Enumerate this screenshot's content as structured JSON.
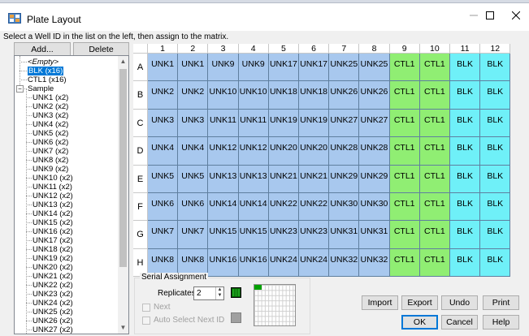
{
  "window": {
    "title": "Plate Layout"
  },
  "instruction": "Select a Well ID in the list on the left, then assign to the matrix.",
  "list_buttons": {
    "add": "Add...",
    "delete": "Delete"
  },
  "tree": {
    "items": [
      {
        "label": "<Empty>",
        "level": 1,
        "selected": false,
        "italic": true
      },
      {
        "label": "BLK (x16)",
        "level": 1,
        "selected": true
      },
      {
        "label": "CTL1 (x16)",
        "level": 1,
        "selected": false
      },
      {
        "label": "Sample",
        "level": 1,
        "selected": false,
        "expander": "−"
      },
      {
        "label": "UNK1 (x2)",
        "level": 2
      },
      {
        "label": "UNK2 (x2)",
        "level": 2
      },
      {
        "label": "UNK3 (x2)",
        "level": 2
      },
      {
        "label": "UNK4 (x2)",
        "level": 2
      },
      {
        "label": "UNK5 (x2)",
        "level": 2
      },
      {
        "label": "UNK6 (x2)",
        "level": 2
      },
      {
        "label": "UNK7 (x2)",
        "level": 2
      },
      {
        "label": "UNK8 (x2)",
        "level": 2
      },
      {
        "label": "UNK9 (x2)",
        "level": 2
      },
      {
        "label": "UNK10 (x2)",
        "level": 2
      },
      {
        "label": "UNK11 (x2)",
        "level": 2
      },
      {
        "label": "UNK12 (x2)",
        "level": 2
      },
      {
        "label": "UNK13 (x2)",
        "level": 2
      },
      {
        "label": "UNK14 (x2)",
        "level": 2
      },
      {
        "label": "UNK15 (x2)",
        "level": 2
      },
      {
        "label": "UNK16 (x2)",
        "level": 2
      },
      {
        "label": "UNK17 (x2)",
        "level": 2
      },
      {
        "label": "UNK18 (x2)",
        "level": 2
      },
      {
        "label": "UNK19 (x2)",
        "level": 2
      },
      {
        "label": "UNK20 (x2)",
        "level": 2
      },
      {
        "label": "UNK21 (x2)",
        "level": 2
      },
      {
        "label": "UNK22 (x2)",
        "level": 2
      },
      {
        "label": "UNK23 (x2)",
        "level": 2
      },
      {
        "label": "UNK24 (x2)",
        "level": 2
      },
      {
        "label": "UNK25 (x2)",
        "level": 2
      },
      {
        "label": "UNK26 (x2)",
        "level": 2
      },
      {
        "label": "UNK27 (x2)",
        "level": 2
      }
    ]
  },
  "plate": {
    "columns": [
      "1",
      "2",
      "3",
      "4",
      "5",
      "6",
      "7",
      "8",
      "9",
      "10",
      "11",
      "12"
    ],
    "rows": [
      {
        "label": "A",
        "cells": [
          "UNK1",
          "UNK1",
          "UNK9",
          "UNK9",
          "UNK17",
          "UNK17",
          "UNK25",
          "UNK25",
          "CTL1",
          "CTL1",
          "BLK",
          "BLK"
        ]
      },
      {
        "label": "B",
        "cells": [
          "UNK2",
          "UNK2",
          "UNK10",
          "UNK10",
          "UNK18",
          "UNK18",
          "UNK26",
          "UNK26",
          "CTL1",
          "CTL1",
          "BLK",
          "BLK"
        ]
      },
      {
        "label": "C",
        "cells": [
          "UNK3",
          "UNK3",
          "UNK11",
          "UNK11",
          "UNK19",
          "UNK19",
          "UNK27",
          "UNK27",
          "CTL1",
          "CTL1",
          "BLK",
          "BLK"
        ]
      },
      {
        "label": "D",
        "cells": [
          "UNK4",
          "UNK4",
          "UNK12",
          "UNK12",
          "UNK20",
          "UNK20",
          "UNK28",
          "UNK28",
          "CTL1",
          "CTL1",
          "BLK",
          "BLK"
        ]
      },
      {
        "label": "E",
        "cells": [
          "UNK5",
          "UNK5",
          "UNK13",
          "UNK13",
          "UNK21",
          "UNK21",
          "UNK29",
          "UNK29",
          "CTL1",
          "CTL1",
          "BLK",
          "BLK"
        ]
      },
      {
        "label": "F",
        "cells": [
          "UNK6",
          "UNK6",
          "UNK14",
          "UNK14",
          "UNK22",
          "UNK22",
          "UNK30",
          "UNK30",
          "CTL1",
          "CTL1",
          "BLK",
          "BLK"
        ]
      },
      {
        "label": "G",
        "cells": [
          "UNK7",
          "UNK7",
          "UNK15",
          "UNK15",
          "UNK23",
          "UNK23",
          "UNK31",
          "UNK31",
          "CTL1",
          "CTL1",
          "BLK",
          "BLK"
        ]
      },
      {
        "label": "H",
        "cells": [
          "UNK8",
          "UNK8",
          "UNK16",
          "UNK16",
          "UNK24",
          "UNK24",
          "UNK32",
          "UNK32",
          "CTL1",
          "CTL1",
          "BLK",
          "BLK"
        ]
      }
    ],
    "colors": {
      "UNK": "#a8c8ee",
      "CTL": "#90ee73",
      "BLK": "#6ff0f8"
    }
  },
  "serial": {
    "group_label": "Serial Assignment",
    "replicates_label": "Replicates:",
    "replicates_value": "2",
    "next_label": "Next",
    "auto_select_label": "Auto Select Next ID"
  },
  "actions": {
    "import": "Import",
    "export": "Export",
    "undo": "Undo",
    "print": "Print",
    "ok": "OK",
    "cancel": "Cancel",
    "help": "Help"
  }
}
